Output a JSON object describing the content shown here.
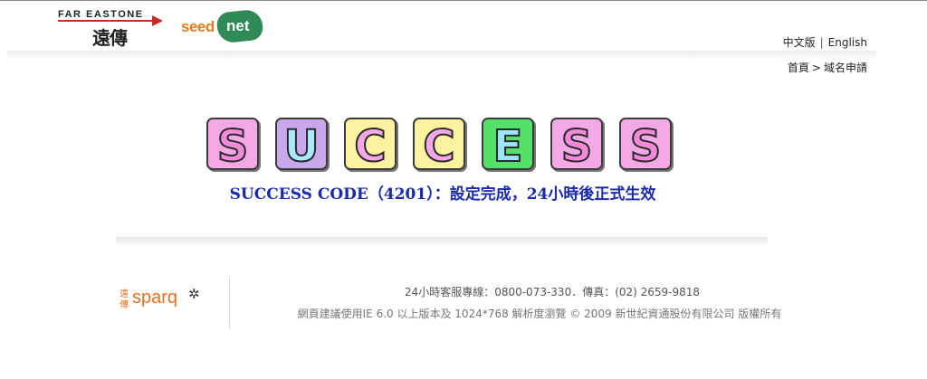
{
  "header": {
    "fet_logo_text": "FAR EASTONE",
    "fet_logo_chinese": "遠傳",
    "seednet_logo": {
      "seed": "seed",
      "net": "net"
    },
    "lang": {
      "chinese": "中文版",
      "separator": "|",
      "english": "English"
    },
    "breadcrumb": {
      "home": "首頁",
      "separator": ">",
      "current": "域名申請"
    }
  },
  "main": {
    "success_tiles": [
      {
        "letter": "S",
        "bg": "#f4a8e6",
        "fg": "#f18ad8"
      },
      {
        "letter": "U",
        "bg": "#c9a8ec",
        "fg": "#a9e8ff"
      },
      {
        "letter": "C",
        "bg": "#fbf3a0",
        "fg": "#f4a8e6"
      },
      {
        "letter": "C",
        "bg": "#fbf3a0",
        "fg": "#f4a8e6"
      },
      {
        "letter": "E",
        "bg": "#54e16a",
        "fg": "#9de6ff"
      },
      {
        "letter": "S",
        "bg": "#f4a8e6",
        "fg": "#f18ad8"
      },
      {
        "letter": "S",
        "bg": "#f4a8e6",
        "fg": "#f18ad8"
      }
    ],
    "message": "SUCCESS CODE（4201）：設定完成，24小時後正式生效"
  },
  "footer": {
    "sparq_chinese": "遠傳",
    "sparq_word": "sparq",
    "sparq_star": "✲",
    "contact": "24小時客服專線：0800-073-330．傳真：(02) 2659-9818",
    "copyright": "網頁建議使用IE 6.0 以上版本及 1024*768 解析度瀏覽 © 2009 新世紀資通股份有限公司 版權所有"
  },
  "colors": {
    "message": "#1a2aa8",
    "fet_red": "#cc2a2a",
    "seed_orange": "#e27c1f",
    "seednet_green": "#2f8a55",
    "sparq_orange": "#e8711f"
  }
}
